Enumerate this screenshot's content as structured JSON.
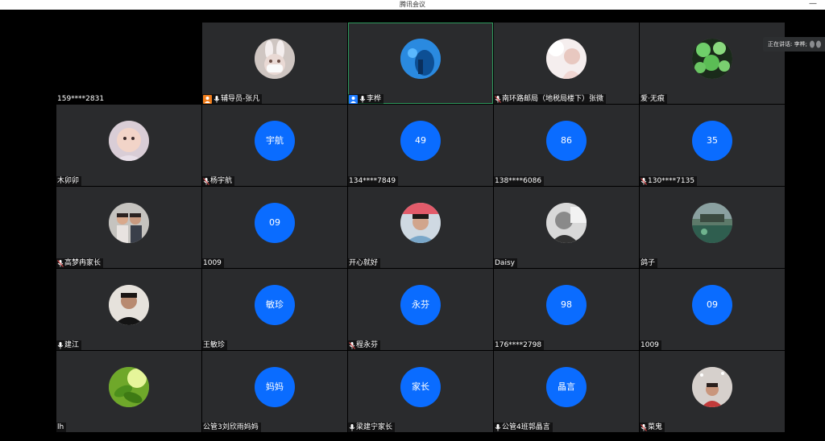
{
  "window": {
    "title": "腾讯会议",
    "minimize": "—"
  },
  "speaking_indicator": {
    "label": "正在讲话: 李桦;"
  },
  "colors": {
    "accent": "#0a6cff",
    "role_host": "#1e7bff",
    "role_assistant": "#f07c1a",
    "active_border": "#2f9a5e"
  },
  "tiles": [
    {
      "name": "159****2831",
      "type": "empty",
      "mic": "none"
    },
    {
      "name": "辅导员-张凡",
      "type": "photo",
      "photo": "bunny-mask-photo",
      "role": "assistant",
      "mic": "on"
    },
    {
      "name": "李桦",
      "type": "photo",
      "photo": "aquarium-photo",
      "role": "host",
      "mic": "on",
      "active": true
    },
    {
      "name": "南环路邮局（地税局楼下）张微",
      "type": "photo",
      "photo": "girl-light-photo",
      "mic": "muted"
    },
    {
      "name": "爱·无痕",
      "type": "photo",
      "photo": "lilypad-photo",
      "mic": "none"
    },
    {
      "name": "木卯卯",
      "type": "photo",
      "photo": "baby-photo",
      "mic": "none"
    },
    {
      "name": "杨宇航",
      "type": "text",
      "avatar_text": "宇航",
      "mic": "muted"
    },
    {
      "name": "134****7849",
      "type": "text",
      "avatar_text": "49",
      "mic": "none"
    },
    {
      "name": "138****6086",
      "type": "text",
      "avatar_text": "86",
      "mic": "none"
    },
    {
      "name": "130****7135",
      "type": "text",
      "avatar_text": "35",
      "mic": "muted"
    },
    {
      "name": "高梦冉家长",
      "type": "photo",
      "photo": "family-photo",
      "mic": "muted"
    },
    {
      "name": "1009",
      "type": "text",
      "avatar_text": "09",
      "mic": "none"
    },
    {
      "name": "开心就好",
      "type": "photo",
      "photo": "man-photo",
      "mic": "none"
    },
    {
      "name": "Daisy",
      "type": "photo",
      "photo": "bw-portrait-photo",
      "mic": "none"
    },
    {
      "name": "鸽子",
      "type": "photo",
      "photo": "pond-photo",
      "mic": "none"
    },
    {
      "name": "建江",
      "type": "photo",
      "photo": "man-selfie-photo",
      "mic": "on"
    },
    {
      "name": "王敏珍",
      "type": "text",
      "avatar_text": "敏珍",
      "mic": "none"
    },
    {
      "name": "程永芬",
      "type": "text",
      "avatar_text": "永芬",
      "mic": "muted"
    },
    {
      "name": "176****2798",
      "type": "text",
      "avatar_text": "98",
      "mic": "none"
    },
    {
      "name": "1009",
      "type": "text",
      "avatar_text": "09",
      "mic": "none"
    },
    {
      "name": "lh",
      "type": "photo",
      "photo": "tea-leaves-photo",
      "mic": "none"
    },
    {
      "name": "公管3刘欣雨妈妈",
      "type": "text",
      "avatar_text": "妈妈",
      "mic": "none"
    },
    {
      "name": "梁建宁家长",
      "type": "text",
      "avatar_text": "家长",
      "mic": "on"
    },
    {
      "name": "公管4班郭晶言",
      "type": "text",
      "avatar_text": "晶言",
      "mic": "on"
    },
    {
      "name": "菜鬼",
      "type": "photo",
      "photo": "woman-snow-photo",
      "mic": "muted"
    }
  ]
}
